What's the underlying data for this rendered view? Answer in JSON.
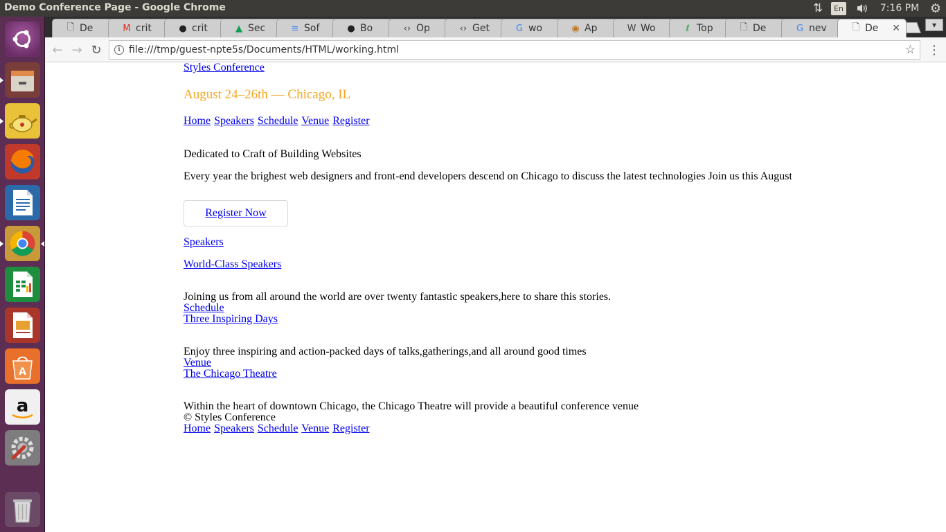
{
  "os": {
    "window_title": "Demo Conference Page - Google Chrome",
    "tray": {
      "language": "En",
      "time": "7:16 PM"
    }
  },
  "launcher": {
    "items": [
      {
        "name": "ubuntu-dash-icon",
        "color": "#e95420"
      },
      {
        "name": "files-icon",
        "color": "#8a5a44"
      },
      {
        "name": "teapot-app-icon",
        "color": "#f2b51b"
      },
      {
        "name": "firefox-icon",
        "color": "#e66000"
      },
      {
        "name": "libreoffice-writer-icon",
        "color": "#2a6aa8"
      },
      {
        "name": "chrome-icon",
        "color": "#4285f4"
      },
      {
        "name": "libreoffice-calc-icon",
        "color": "#1e8e3e"
      },
      {
        "name": "libreoffice-impress-icon",
        "color": "#c0392b"
      },
      {
        "name": "software-center-icon",
        "color": "#e8702a"
      },
      {
        "name": "amazon-icon",
        "color": "#ff9900"
      },
      {
        "name": "system-settings-icon",
        "color": "#c0392b"
      },
      {
        "name": "trash-icon",
        "color": "#999999"
      }
    ]
  },
  "browser": {
    "tabs": [
      {
        "label": "De",
        "icon": "page-icon"
      },
      {
        "label": "crit",
        "icon": "gmail-icon"
      },
      {
        "label": "crit",
        "icon": "github-icon"
      },
      {
        "label": "Sec",
        "icon": "google-drive-icon"
      },
      {
        "label": "Sof",
        "icon": "google-docs-icon"
      },
      {
        "label": "Bo",
        "icon": "github-icon"
      },
      {
        "label": "Op",
        "icon": "code-icon"
      },
      {
        "label": "Get",
        "icon": "code-icon"
      },
      {
        "label": "wo",
        "icon": "google-icon"
      },
      {
        "label": "Ap",
        "icon": "app-icon"
      },
      {
        "label": "Wo",
        "icon": "wikipedia-icon"
      },
      {
        "label": "Top",
        "icon": "leaf-icon"
      },
      {
        "label": "De",
        "icon": "page-icon"
      },
      {
        "label": "nev",
        "icon": "google-icon"
      },
      {
        "label": "De",
        "icon": "page-icon",
        "active": true
      }
    ],
    "url": "file:///tmp/guest-npte5s/Documents/HTML/working.html"
  },
  "page": {
    "site_title": "Styles Conference",
    "date_location": "August 24–26th — Chicago, IL",
    "nav": [
      "Home",
      "Speakers",
      "Schedule",
      "Venue",
      "Register"
    ],
    "tagline": "Dedicated to Craft of Building Websites",
    "intro": "Every year the brighest web designers and front-end developers descend on Chicago to discuss the latest technologies Join us this August",
    "register_button": "Register Now",
    "speakers_link": "Speakers",
    "speakers_heading": "World-Class Speakers",
    "speakers_text": "Joining us from all around the world are over twenty fantastic speakers,here to share this stories.",
    "schedule_link": "Schedule",
    "schedule_heading": "Three Inspiring Days",
    "schedule_text": "Enjoy three inspiring and action-packed days of talks,gatherings,and all around good times",
    "venue_link": "Venue",
    "venue_heading": "The Chicago Theatre",
    "venue_text": "Within the heart of downtown Chicago, the Chicago Theatre will provide a beautiful conference venue",
    "footer_copyright": "© Styles Conference",
    "footer_nav": [
      "Home",
      "Speakers",
      "Schedule",
      "Venue",
      "Register"
    ]
  }
}
